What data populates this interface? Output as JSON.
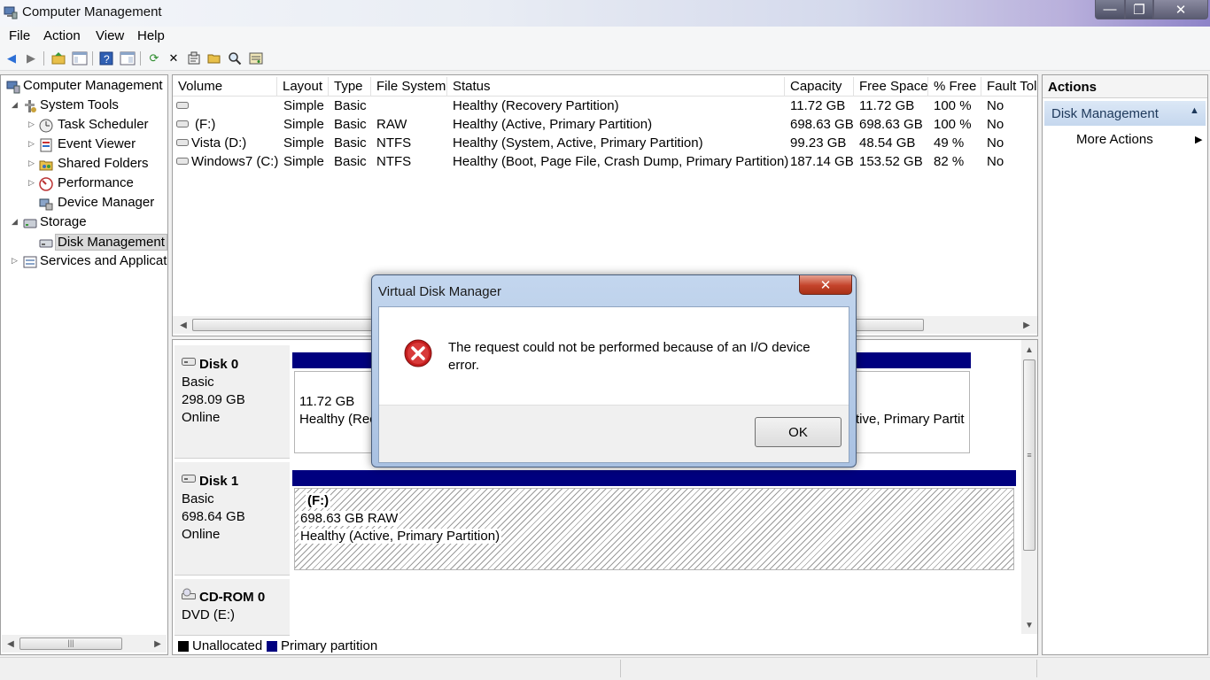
{
  "window": {
    "title": "Computer Management",
    "min": "—",
    "max": "❐",
    "close": "✕"
  },
  "menu": [
    "File",
    "Action",
    "View",
    "Help"
  ],
  "tree": {
    "root": "Computer Management",
    "system_tools": "System Tools",
    "task_scheduler": "Task Scheduler",
    "event_viewer": "Event Viewer",
    "shared_folders": "Shared Folders",
    "performance": "Performance",
    "device_manager": "Device Manager",
    "storage": "Storage",
    "disk_management": "Disk Management",
    "services": "Services and Applicat"
  },
  "volumes": {
    "columns": [
      "Volume",
      "Layout",
      "Type",
      "File System",
      "Status",
      "Capacity",
      "Free Space",
      "% Free",
      "Fault Tol"
    ],
    "rows": [
      [
        "",
        "Simple",
        "Basic",
        "",
        "Healthy (Recovery Partition)",
        "11.72 GB",
        "11.72 GB",
        "100 %",
        "No"
      ],
      [
        "(F:)",
        "Simple",
        "Basic",
        "RAW",
        "Healthy (Active, Primary Partition)",
        "698.63 GB",
        "698.63 GB",
        "100 %",
        "No"
      ],
      [
        "Vista (D:)",
        "Simple",
        "Basic",
        "NTFS",
        "Healthy (System, Active, Primary Partition)",
        "99.23 GB",
        "48.54 GB",
        "49 %",
        "No"
      ],
      [
        "Windows7 (C:)",
        "Simple",
        "Basic",
        "NTFS",
        "Healthy (Boot, Page File, Crash Dump, Primary Partition)",
        "187.14 GB",
        "153.52 GB",
        "82 %",
        "No"
      ]
    ]
  },
  "disks": {
    "disk0": {
      "name": "Disk 0",
      "type": "Basic",
      "size": "298.09 GB",
      "state": "Online",
      "part1_size": "11.72 GB",
      "part1_status": "Healthy (Rec",
      "part_last_status": "tive, Primary Partit"
    },
    "disk1": {
      "name": "Disk 1",
      "type": "Basic",
      "size": "698.64 GB",
      "state": "Online",
      "part_name": "(F:)",
      "part_size": "698.63 GB RAW",
      "part_status": "Healthy (Active, Primary Partition)"
    },
    "cdrom0": {
      "name": "CD-ROM 0",
      "drive": "DVD (E:)"
    }
  },
  "legend": {
    "unallocated": "Unallocated",
    "primary": "Primary partition"
  },
  "actions": {
    "header": "Actions",
    "section": "Disk Management",
    "more": "More Actions"
  },
  "dialog": {
    "title": "Virtual Disk Manager",
    "message": "The request could not be performed because of an I/O device error.",
    "ok": "OK",
    "close": "✕"
  },
  "colors": {
    "primary_partition": "#00007f",
    "selection": "#dadada",
    "error": "#c41e1e"
  }
}
